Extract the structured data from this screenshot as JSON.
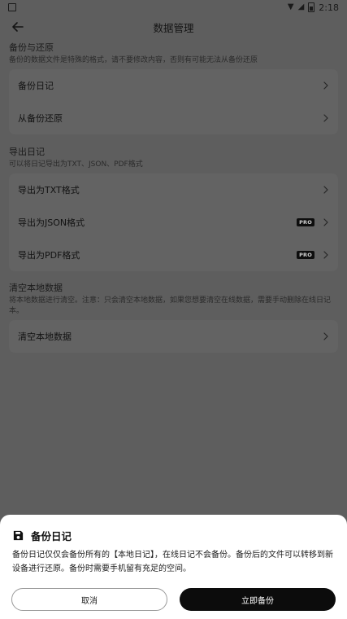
{
  "status_bar": {
    "time": "2:18"
  },
  "app_bar": {
    "title": "数据管理"
  },
  "sections": [
    {
      "title": "备份与还原",
      "description": "备份的数据文件是特殊的格式，请不要修改内容，否则有可能无法从备份还原",
      "items": [
        {
          "label": "备份日记"
        },
        {
          "label": "从备份还原"
        }
      ]
    },
    {
      "title": "导出日记",
      "description": "可以将日记导出为TXT、JSON、PDF格式",
      "items": [
        {
          "label": "导出为TXT格式"
        },
        {
          "label": "导出为JSON格式",
          "badge": "PRO"
        },
        {
          "label": "导出为PDF格式",
          "badge": "PRO"
        }
      ]
    },
    {
      "title": "清空本地数据",
      "description": "将本地数据进行清空。注意：只会清空本地数据，如果您想要清空在线数据，需要手动删除在线日记本。",
      "items": [
        {
          "label": "清空本地数据"
        }
      ]
    }
  ],
  "bottom_sheet": {
    "title": "备份日记",
    "body": "备份日记仅仅会备份所有的【本地日记】，在线日记不会备份。备份后的文件可以转移到新设备进行还原。备份时需要手机留有充足的空间。",
    "cancel_label": "取消",
    "confirm_label": "立即备份"
  },
  "icons": {
    "back": "arrow-left-icon",
    "chevron": "chevron-right-icon",
    "save": "floppy-disk-icon",
    "wifi": "wifi-icon",
    "signal": "signal-icon",
    "battery": "battery-icon"
  },
  "colors": {
    "scrim_background": "#5e5e5e",
    "card_background": "#636363",
    "sheet_background": "#ffffff",
    "primary_button": "#0c0c0c",
    "pro_badge": "#0e0e0e"
  }
}
